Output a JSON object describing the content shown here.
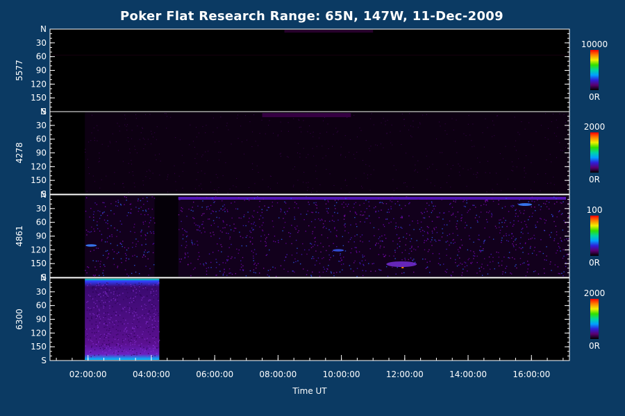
{
  "chart_data": {
    "type": "heatmap",
    "title": "Poker Flat Research Range: 65N, 147W, 11-Dec-2009",
    "xlabel": "Time UT",
    "x_ticks": [
      "02:00:00",
      "04:00:00",
      "06:00:00",
      "08:00:00",
      "10:00:00",
      "12:00:00",
      "14:00:00",
      "16:00:00"
    ],
    "x_tick_hours": [
      2,
      4,
      6,
      8,
      10,
      12,
      14,
      16
    ],
    "xlim_hours": [
      0.8,
      17.2
    ],
    "panels": [
      {
        "label": "5577",
        "y_ticks": [
          "N",
          "30",
          "60",
          "90",
          "120",
          "150",
          "S"
        ],
        "y_tick_values": [
          0,
          30,
          60,
          90,
          120,
          150,
          180
        ],
        "ylim": [
          0,
          180
        ],
        "colorbar_max": "10000",
        "colorbar_min": "0R",
        "intensity": "very low"
      },
      {
        "label": "4278",
        "y_ticks": [
          "N",
          "30",
          "60",
          "90",
          "120",
          "150",
          "S"
        ],
        "y_tick_values": [
          0,
          30,
          60,
          90,
          120,
          150,
          180
        ],
        "ylim": [
          0,
          180
        ],
        "colorbar_max": "2000",
        "colorbar_min": "0R",
        "intensity": "low"
      },
      {
        "label": "4861",
        "y_ticks": [
          "N",
          "30",
          "60",
          "90",
          "120",
          "150",
          "S"
        ],
        "y_tick_values": [
          0,
          30,
          60,
          90,
          120,
          150,
          180
        ],
        "ylim": [
          0,
          180
        ],
        "colorbar_max": "100",
        "colorbar_min": "0R",
        "intensity": "speckled"
      },
      {
        "label": "6300",
        "y_ticks": [
          "N",
          "30",
          "60",
          "90",
          "120",
          "150",
          "S"
        ],
        "y_tick_values": [
          0,
          30,
          60,
          90,
          120,
          150,
          180
        ],
        "ylim": [
          0,
          180
        ],
        "colorbar_max": "2000",
        "colorbar_min": "0R",
        "intensity": "bright early block"
      }
    ],
    "colormap": [
      "#000000",
      "#5a006e",
      "#2f1fd8",
      "#00a0ff",
      "#00d6a0",
      "#30e000",
      "#f0f000",
      "#ff8000",
      "#ff0000"
    ]
  },
  "colors": {
    "background": "#0b3a63",
    "plot_area": "#000000",
    "axis": "#ffffff"
  }
}
